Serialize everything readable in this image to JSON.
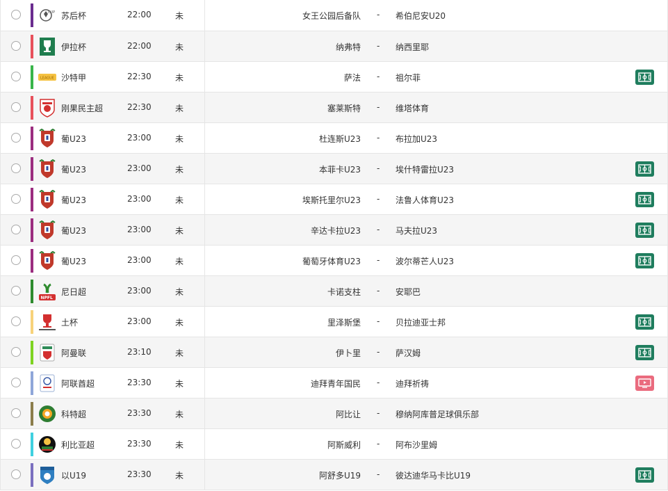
{
  "colors": {
    "field_button": "#1f7d5e",
    "video_button": "#ea6b7e",
    "row_alt_bg": "#f5f5f5"
  },
  "matches": [
    {
      "league": "苏后杯",
      "time": "22:00",
      "status": "未",
      "home": "女王公园后备队",
      "sep": "-",
      "away": "希伯尼安U20",
      "stripe": "#6a2c8f",
      "logo": "soccer-cup-logo",
      "media": ""
    },
    {
      "league": "伊拉杯",
      "time": "22:00",
      "status": "未",
      "home": "纳弗特",
      "sep": "-",
      "away": "纳西里耶",
      "stripe": "#e8505b",
      "logo": "green-trophy-logo",
      "media": ""
    },
    {
      "league": "沙特甲",
      "time": "22:30",
      "status": "未",
      "home": "萨法",
      "sep": "-",
      "away": "祖尔菲",
      "stripe": "#39b54a",
      "logo": "yellow-banner-logo",
      "media": "field"
    },
    {
      "league": "刚果民主超",
      "time": "22:30",
      "status": "未",
      "home": "塞莱斯特",
      "sep": "-",
      "away": "维塔体育",
      "stripe": "#e8505b",
      "logo": "red-shield-logo",
      "media": ""
    },
    {
      "league": "葡U23",
      "time": "23:00",
      "status": "未",
      "home": "杜连斯U23",
      "sep": "-",
      "away": "布拉加U23",
      "stripe": "#9b2d7f",
      "logo": "portugal-crest-logo",
      "media": ""
    },
    {
      "league": "葡U23",
      "time": "23:00",
      "status": "未",
      "home": "本菲卡U23",
      "sep": "-",
      "away": "埃什特雷拉U23",
      "stripe": "#9b2d7f",
      "logo": "portugal-crest-logo",
      "media": "field"
    },
    {
      "league": "葡U23",
      "time": "23:00",
      "status": "未",
      "home": "埃斯托里尔U23",
      "sep": "-",
      "away": "法鲁人体育U23",
      "stripe": "#9b2d7f",
      "logo": "portugal-crest-logo",
      "media": "field"
    },
    {
      "league": "葡U23",
      "time": "23:00",
      "status": "未",
      "home": "辛达卡拉U23",
      "sep": "-",
      "away": "马夫拉U23",
      "stripe": "#9b2d7f",
      "logo": "portugal-crest-logo",
      "media": "field"
    },
    {
      "league": "葡U23",
      "time": "23:00",
      "status": "未",
      "home": "葡萄牙体育U23",
      "sep": "-",
      "away": "波尔蒂芒人U23",
      "stripe": "#9b2d7f",
      "logo": "portugal-crest-logo",
      "media": "field"
    },
    {
      "league": "尼日超",
      "time": "23:00",
      "status": "未",
      "home": "卡诺支柱",
      "sep": "-",
      "away": "安耶巴",
      "stripe": "#2e8b2e",
      "logo": "npfl-logo",
      "media": ""
    },
    {
      "league": "土杯",
      "time": "23:00",
      "status": "未",
      "home": "里泽斯堡",
      "sep": "-",
      "away": "贝拉迪亚士邦",
      "stripe": "#f7d27a",
      "logo": "turkiye-kupasi-logo",
      "media": "field"
    },
    {
      "league": "阿曼联",
      "time": "23:10",
      "status": "未",
      "home": "伊卜里",
      "sep": "-",
      "away": "萨汉姆",
      "stripe": "#7ed321",
      "logo": "oman-league-logo",
      "media": "field"
    },
    {
      "league": "阿联酋超",
      "time": "23:30",
      "status": "未",
      "home": "迪拜青年国民",
      "sep": "-",
      "away": "迪拜祈祷",
      "stripe": "#8fa6d9",
      "logo": "uae-league-logo",
      "media": "video"
    },
    {
      "league": "科特超",
      "time": "23:30",
      "status": "未",
      "home": "阿比让",
      "sep": "-",
      "away": "穆纳阿库普足球俱乐部",
      "stripe": "#8b7d4b",
      "logo": "ivory-coast-logo",
      "media": ""
    },
    {
      "league": "利比亚超",
      "time": "23:30",
      "status": "未",
      "home": "阿斯威利",
      "sep": "-",
      "away": "阿布沙里姆",
      "stripe": "#3fd0e0",
      "logo": "libya-league-logo",
      "media": ""
    },
    {
      "league": "以U19",
      "time": "23:30",
      "status": "未",
      "home": "阿舒多U19",
      "sep": "-",
      "away": "彼达迪华马卡比U19",
      "stripe": "#7a6fbf",
      "logo": "israel-fa-logo",
      "media": "field"
    }
  ]
}
